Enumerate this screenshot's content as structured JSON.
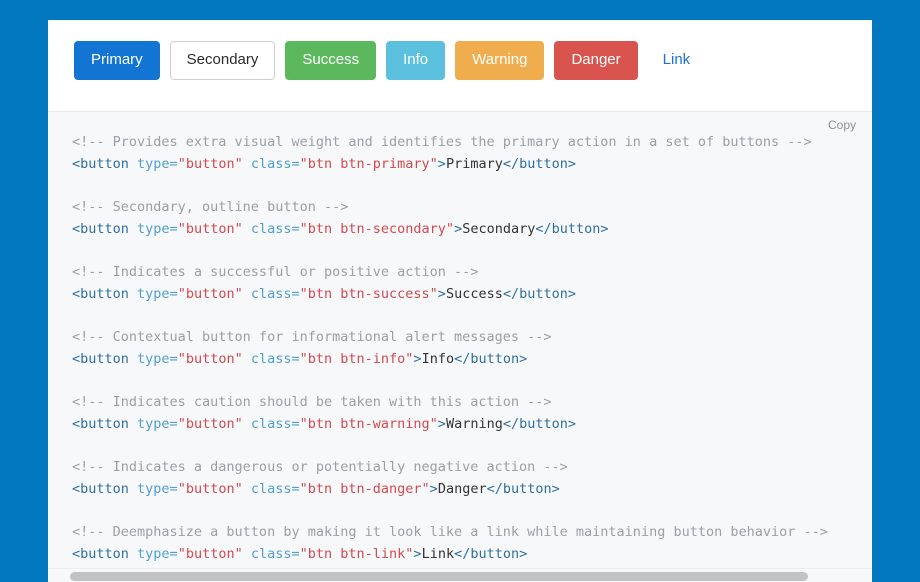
{
  "background_color": "#0178bf",
  "preview": {
    "buttons": [
      {
        "label": "Primary",
        "variant": "btn-primary",
        "name": "primary-button",
        "color": "#1275d4"
      },
      {
        "label": "Secondary",
        "variant": "btn-secondary",
        "name": "secondary-button",
        "color": "#ffffff"
      },
      {
        "label": "Success",
        "variant": "btn-success",
        "name": "success-button",
        "color": "#5cb85c"
      },
      {
        "label": "Info",
        "variant": "btn-info",
        "name": "info-button",
        "color": "#5bc0de"
      },
      {
        "label": "Warning",
        "variant": "btn-warning",
        "name": "warning-button",
        "color": "#efad4d"
      },
      {
        "label": "Danger",
        "variant": "btn-danger",
        "name": "danger-button",
        "color": "#d9534f"
      },
      {
        "label": "Link",
        "variant": "btn-link",
        "name": "link-button",
        "color": "#1a73d4"
      }
    ]
  },
  "code_block": {
    "copy_label": "Copy",
    "background": "#f7f8f9",
    "colors": {
      "comment": "#9aa0a6",
      "tag": "#2f6f9f",
      "attribute": "#4f9fcf",
      "value": "#d44950",
      "text": "#333333"
    },
    "lines": [
      {
        "type": "comment",
        "text": "<!-- Provides extra visual weight and identifies the primary action in a set of buttons -->"
      },
      {
        "type": "markup",
        "tag_open": "<button",
        "attr1_name": " type=",
        "attr1_value": "\"button\"",
        "attr2_name": " class=",
        "attr2_value": "\"btn btn-primary\"",
        "gt": ">",
        "inner": "Primary",
        "tag_close": "</button>"
      },
      {
        "type": "blank"
      },
      {
        "type": "comment",
        "text": "<!-- Secondary, outline button -->"
      },
      {
        "type": "markup",
        "tag_open": "<button",
        "attr1_name": " type=",
        "attr1_value": "\"button\"",
        "attr2_name": " class=",
        "attr2_value": "\"btn btn-secondary\"",
        "gt": ">",
        "inner": "Secondary",
        "tag_close": "</button>"
      },
      {
        "type": "blank"
      },
      {
        "type": "comment",
        "text": "<!-- Indicates a successful or positive action -->"
      },
      {
        "type": "markup",
        "tag_open": "<button",
        "attr1_name": " type=",
        "attr1_value": "\"button\"",
        "attr2_name": " class=",
        "attr2_value": "\"btn btn-success\"",
        "gt": ">",
        "inner": "Success",
        "tag_close": "</button>"
      },
      {
        "type": "blank"
      },
      {
        "type": "comment",
        "text": "<!-- Contextual button for informational alert messages -->"
      },
      {
        "type": "markup",
        "tag_open": "<button",
        "attr1_name": " type=",
        "attr1_value": "\"button\"",
        "attr2_name": " class=",
        "attr2_value": "\"btn btn-info\"",
        "gt": ">",
        "inner": "Info",
        "tag_close": "</button>"
      },
      {
        "type": "blank"
      },
      {
        "type": "comment",
        "text": "<!-- Indicates caution should be taken with this action -->"
      },
      {
        "type": "markup",
        "tag_open": "<button",
        "attr1_name": " type=",
        "attr1_value": "\"button\"",
        "attr2_name": " class=",
        "attr2_value": "\"btn btn-warning\"",
        "gt": ">",
        "inner": "Warning",
        "tag_close": "</button>"
      },
      {
        "type": "blank"
      },
      {
        "type": "comment",
        "text": "<!-- Indicates a dangerous or potentially negative action -->"
      },
      {
        "type": "markup",
        "tag_open": "<button",
        "attr1_name": " type=",
        "attr1_value": "\"button\"",
        "attr2_name": " class=",
        "attr2_value": "\"btn btn-danger\"",
        "gt": ">",
        "inner": "Danger",
        "tag_close": "</button>"
      },
      {
        "type": "blank"
      },
      {
        "type": "comment",
        "text": "<!-- Deemphasize a button by making it look like a link while maintaining button behavior -->"
      },
      {
        "type": "markup",
        "tag_open": "<button",
        "attr1_name": " type=",
        "attr1_value": "\"button\"",
        "attr2_name": " class=",
        "attr2_value": "\"btn btn-link\"",
        "gt": ">",
        "inner": "Link",
        "tag_close": "</button>"
      }
    ]
  },
  "scrollbar": {
    "orientation": "horizontal",
    "thumb_color": "#c2c2c2",
    "track_color": "#f7f8f9"
  }
}
